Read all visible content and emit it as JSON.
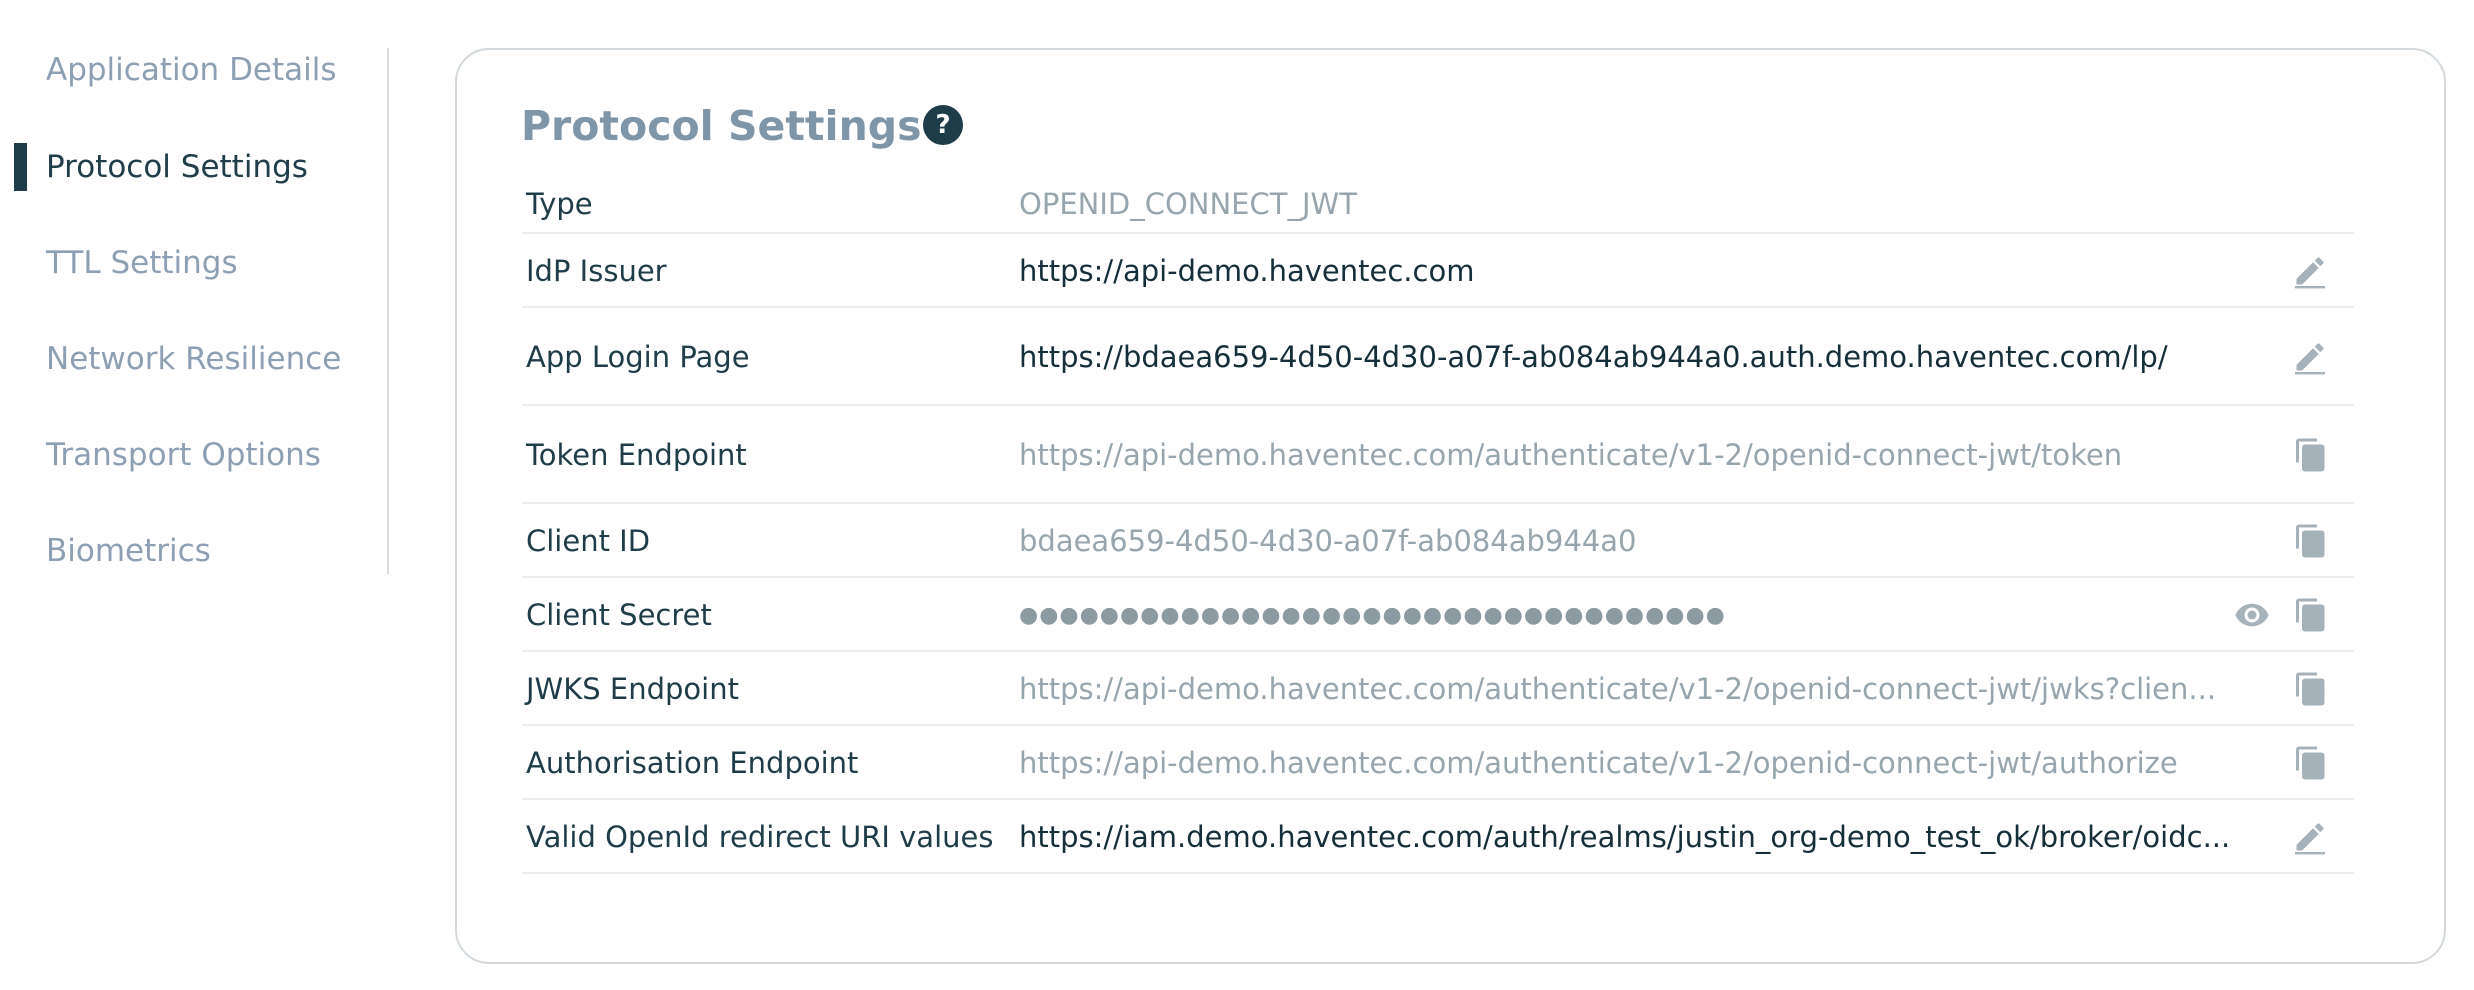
{
  "sidebar": {
    "items": [
      {
        "label": "Application Details"
      },
      {
        "label": "Protocol Settings",
        "active": true
      },
      {
        "label": "TTL Settings"
      },
      {
        "label": "Network Resilience"
      },
      {
        "label": "Transport Options"
      },
      {
        "label": "Biometrics"
      }
    ]
  },
  "card": {
    "title": "Protocol Settings",
    "help_icon": "?"
  },
  "rows": [
    {
      "label": "Type",
      "value": "OPENID_CONNECT_JWT"
    },
    {
      "label": "IdP Issuer",
      "value": "https://api-demo.haventec.com",
      "action": "edit"
    },
    {
      "label": "App Login Page",
      "value": "https://bdaea659-4d50-4d30-a07f-ab084ab944a0.auth.demo.haventec.com/lp/",
      "action": "edit"
    },
    {
      "label": "Token Endpoint",
      "value": "https://api-demo.haventec.com/authenticate/v1-2/openid-connect-jwt/token",
      "action": "copy"
    },
    {
      "label": "Client ID",
      "value": "bdaea659-4d50-4d30-a07f-ab084ab944a0",
      "action": "copy"
    },
    {
      "label": "Client Secret",
      "value": "●●●●●●●●●●●●●●●●●●●●●●●●●●●●●●●●●●●",
      "actions": [
        "eye",
        "copy"
      ]
    },
    {
      "label": "JWKS Endpoint",
      "value": "https://api-demo.haventec.com/authenticate/v1-2/openid-connect-jwt/jwks?clien...",
      "action": "copy"
    },
    {
      "label": "Authorisation Endpoint",
      "value": "https://api-demo.haventec.com/authenticate/v1-2/openid-connect-jwt/authorize",
      "action": "copy"
    },
    {
      "label": "Valid OpenId redirect URI values",
      "value": "https://iam.demo.haventec.com/auth/realms/justin_org-demo_test_ok/broker/oidc...",
      "action": "edit"
    }
  ],
  "icons": {
    "help": "question-circle-icon",
    "edit": "pencil-icon",
    "copy": "copy-icon",
    "reveal": "eye-icon"
  },
  "colors": {
    "accent": "#1f3d49",
    "muted_text": "#8da0b3",
    "border": "#d3d9dd"
  }
}
